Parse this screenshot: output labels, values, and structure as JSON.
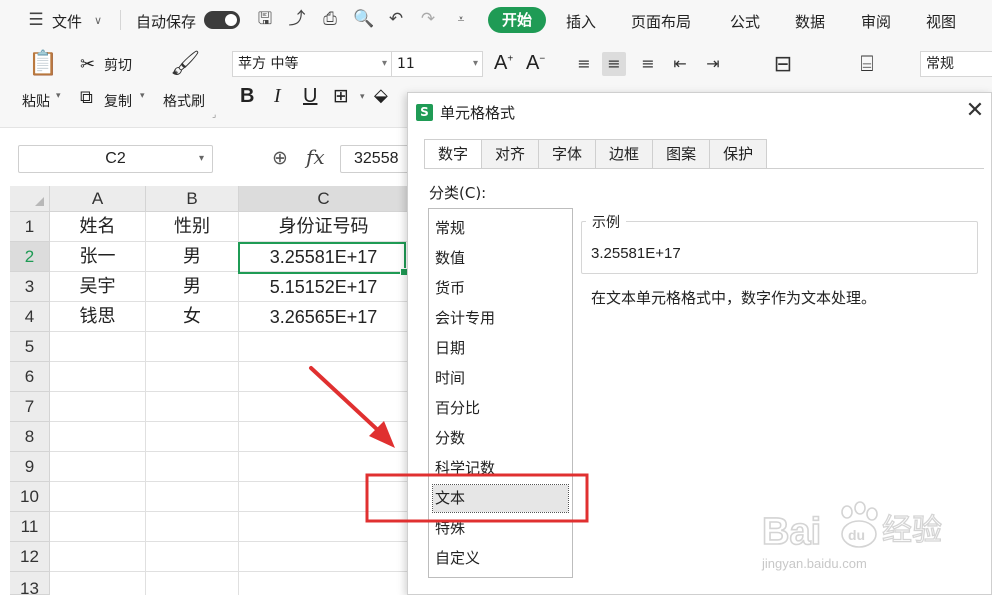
{
  "menubar": {
    "file_menu": "文件",
    "autosave_label": "自动保存",
    "tabs": [
      "开始",
      "插入",
      "页面布局",
      "公式",
      "数据",
      "审阅",
      "视图"
    ]
  },
  "ribbon": {
    "paste": "粘贴",
    "cut": "剪切",
    "copy": "复制",
    "format_painter": "格式刷",
    "font_name": "苹方 中等",
    "font_size": "11",
    "number_format": "常规"
  },
  "formula_bar": {
    "name_box": "C2",
    "fx_label": "fx",
    "value": "32558"
  },
  "sheet": {
    "columns": [
      "A",
      "B",
      "C"
    ],
    "rows": [
      "1",
      "2",
      "3",
      "4",
      "5",
      "6",
      "7",
      "8",
      "9",
      "10",
      "11",
      "12",
      "13"
    ],
    "data": [
      [
        "姓名",
        "性别",
        "身份证号码"
      ],
      [
        "张一",
        "男",
        "3.25581E+17"
      ],
      [
        "吴宇",
        "男",
        "5.15152E+17"
      ],
      [
        "钱思",
        "女",
        "3.26565E+17"
      ]
    ]
  },
  "dialog": {
    "title": "单元格格式",
    "tabs": [
      "数字",
      "对齐",
      "字体",
      "边框",
      "图案",
      "保护"
    ],
    "category_label": "分类(C):",
    "categories": [
      "常规",
      "数值",
      "货币",
      "会计专用",
      "日期",
      "时间",
      "百分比",
      "分数",
      "科学记数",
      "文本",
      "特殊",
      "自定义"
    ],
    "selected_category": "文本",
    "sample_label": "示例",
    "sample_value": "3.25581E+17",
    "description": "在文本单元格格式中，数字作为文本处理。"
  },
  "watermark": {
    "text": "jingyan.baidu.com"
  },
  "colors": {
    "accent_green": "#1f9b55",
    "annotation_red": "#e03030",
    "selection_gray": "#e6e6e6"
  }
}
